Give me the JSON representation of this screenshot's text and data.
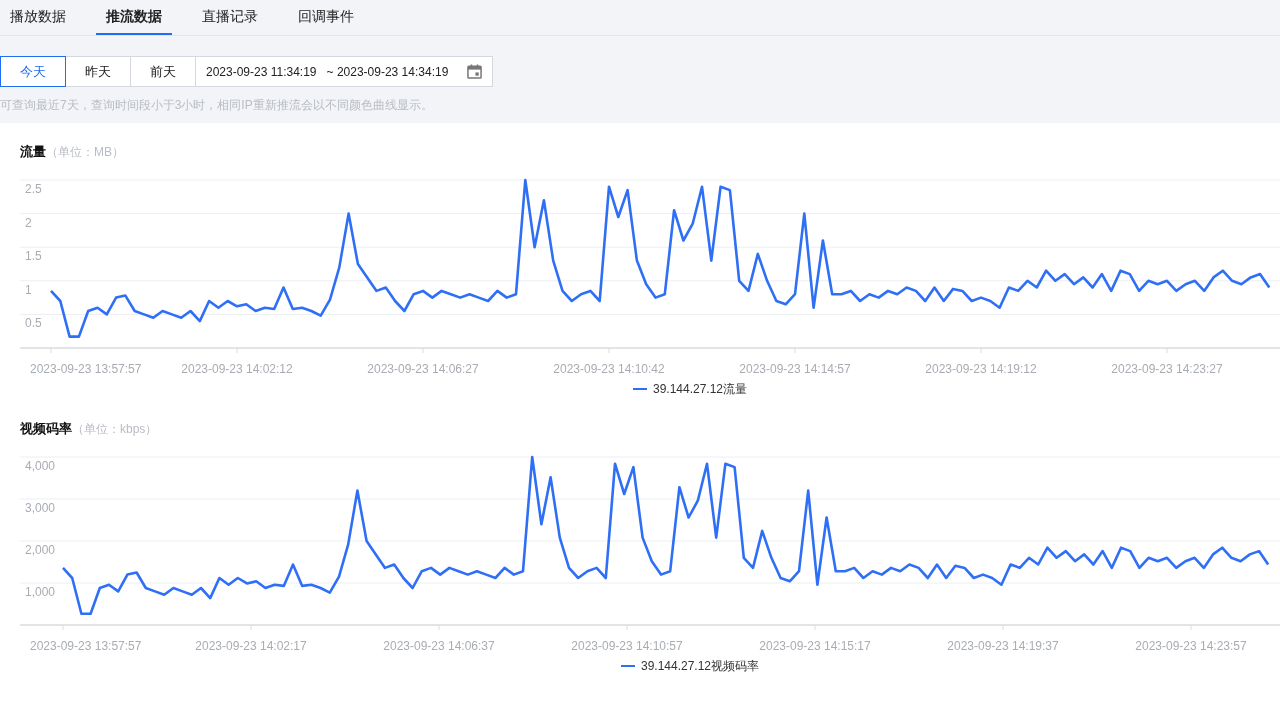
{
  "tabs": [
    {
      "label": "播放数据",
      "selected": false
    },
    {
      "label": "推流数据",
      "selected": true
    },
    {
      "label": "直播记录",
      "selected": false
    },
    {
      "label": "回调事件",
      "selected": false
    }
  ],
  "quick_ranges": [
    {
      "label": "今天",
      "selected": true
    },
    {
      "label": "昨天",
      "selected": false
    },
    {
      "label": "前天",
      "selected": false
    }
  ],
  "date_range": {
    "start": "2023-09-23 11:34:19",
    "end": "~ 2023-09-23 14:34:19"
  },
  "hint": "可查询最近7天，查询时间段小于3小时，相同IP重新推流会以不同颜色曲线显示。",
  "charts": [
    {
      "unit": "（单位：MB）",
      "x_axis_labels": [
        "2023-09-23 13:57:57",
        "2023-09-23 14:02:12",
        "2023-09-23 14:06:27",
        "2023-09-23 14:10:42",
        "2023-09-23 14:14:57",
        "2023-09-23 14:19:12",
        "2023-09-23 14:23:27"
      ],
      "chart_data": {
        "type": "line",
        "title": "流量",
        "grid": true,
        "ylim": [
          0,
          2.5
        ],
        "yticks": [
          0.5,
          1,
          1.5,
          2,
          2.5
        ],
        "series": [
          {
            "name": "39.144.27.12流量",
            "color": "#2f6ff6",
            "values": [
              0.85,
              0.7,
              0.17,
              0.17,
              0.55,
              0.6,
              0.5,
              0.75,
              0.78,
              0.55,
              0.5,
              0.45,
              0.55,
              0.5,
              0.45,
              0.55,
              0.4,
              0.7,
              0.6,
              0.7,
              0.62,
              0.65,
              0.55,
              0.6,
              0.58,
              0.9,
              0.58,
              0.6,
              0.55,
              0.48,
              0.72,
              1.2,
              2.0,
              1.25,
              1.05,
              0.85,
              0.9,
              0.7,
              0.55,
              0.8,
              0.85,
              0.75,
              0.85,
              0.8,
              0.75,
              0.8,
              0.75,
              0.7,
              0.85,
              0.75,
              0.8,
              2.5,
              1.5,
              2.2,
              1.3,
              0.85,
              0.7,
              0.8,
              0.85,
              0.7,
              2.4,
              1.95,
              2.35,
              1.3,
              0.95,
              0.75,
              0.8,
              2.05,
              1.6,
              1.85,
              2.4,
              1.3,
              2.4,
              2.35,
              1.0,
              0.85,
              1.4,
              1.0,
              0.7,
              0.65,
              0.8,
              2.0,
              0.6,
              1.6,
              0.8,
              0.8,
              0.85,
              0.7,
              0.8,
              0.75,
              0.85,
              0.8,
              0.9,
              0.85,
              0.7,
              0.9,
              0.7,
              0.88,
              0.85,
              0.7,
              0.75,
              0.7,
              0.6,
              0.9,
              0.85,
              1.0,
              0.9,
              1.15,
              1.0,
              1.1,
              0.95,
              1.05,
              0.9,
              1.1,
              0.85,
              1.15,
              1.1,
              0.85,
              1.0,
              0.95,
              1.0,
              0.85,
              0.95,
              1.0,
              0.85,
              1.05,
              1.15,
              1.0,
              0.95,
              1.05,
              1.1,
              0.9
            ]
          }
        ]
      }
    },
    {
      "unit": "（单位：kbps）",
      "x_axis_labels": [
        "2023-09-23 13:57:57",
        "2023-09-23 14:02:17",
        "2023-09-23 14:06:37",
        "2023-09-23 14:10:57",
        "2023-09-23 14:15:17",
        "2023-09-23 14:19:37",
        "2023-09-23 14:23:57"
      ],
      "chart_data": {
        "type": "line",
        "title": "视频码率",
        "grid": true,
        "ylim": [
          0,
          4000
        ],
        "yticks": [
          {
            "value": 1000,
            "label": "1,000"
          },
          {
            "value": 2000,
            "label": "2,000"
          },
          {
            "value": 3000,
            "label": "3,000"
          },
          {
            "value": 4000,
            "label": "4,000"
          }
        ],
        "series": [
          {
            "name": "39.144.27.12视频码率",
            "color": "#2f6ff6",
            "values": [
              1360,
              1120,
              270,
              270,
              880,
              960,
              800,
              1200,
              1250,
              880,
              800,
              720,
              880,
              800,
              720,
              880,
              640,
              1120,
              960,
              1120,
              990,
              1040,
              880,
              960,
              930,
              1440,
              930,
              960,
              880,
              770,
              1150,
              1920,
              3200,
              2000,
              1680,
              1360,
              1440,
              1120,
              880,
              1280,
              1360,
              1200,
              1360,
              1280,
              1200,
              1280,
              1200,
              1120,
              1360,
              1200,
              1280,
              4000,
              2400,
              3520,
              2080,
              1360,
              1120,
              1280,
              1360,
              1120,
              3840,
              3120,
              3760,
              2080,
              1520,
              1200,
              1280,
              3280,
              2560,
              2960,
              3840,
              2080,
              3840,
              3760,
              1600,
              1360,
              2240,
              1600,
              1120,
              1040,
              1280,
              3200,
              960,
              2560,
              1280,
              1280,
              1360,
              1120,
              1280,
              1200,
              1360,
              1280,
              1440,
              1360,
              1120,
              1440,
              1120,
              1410,
              1360,
              1120,
              1200,
              1120,
              960,
              1440,
              1360,
              1600,
              1440,
              1840,
              1600,
              1760,
              1520,
              1680,
              1440,
              1760,
              1360,
              1840,
              1760,
              1360,
              1600,
              1520,
              1600,
              1360,
              1520,
              1600,
              1360,
              1680,
              1840,
              1600,
              1520,
              1680,
              1760,
              1440
            ]
          }
        ]
      }
    }
  ]
}
